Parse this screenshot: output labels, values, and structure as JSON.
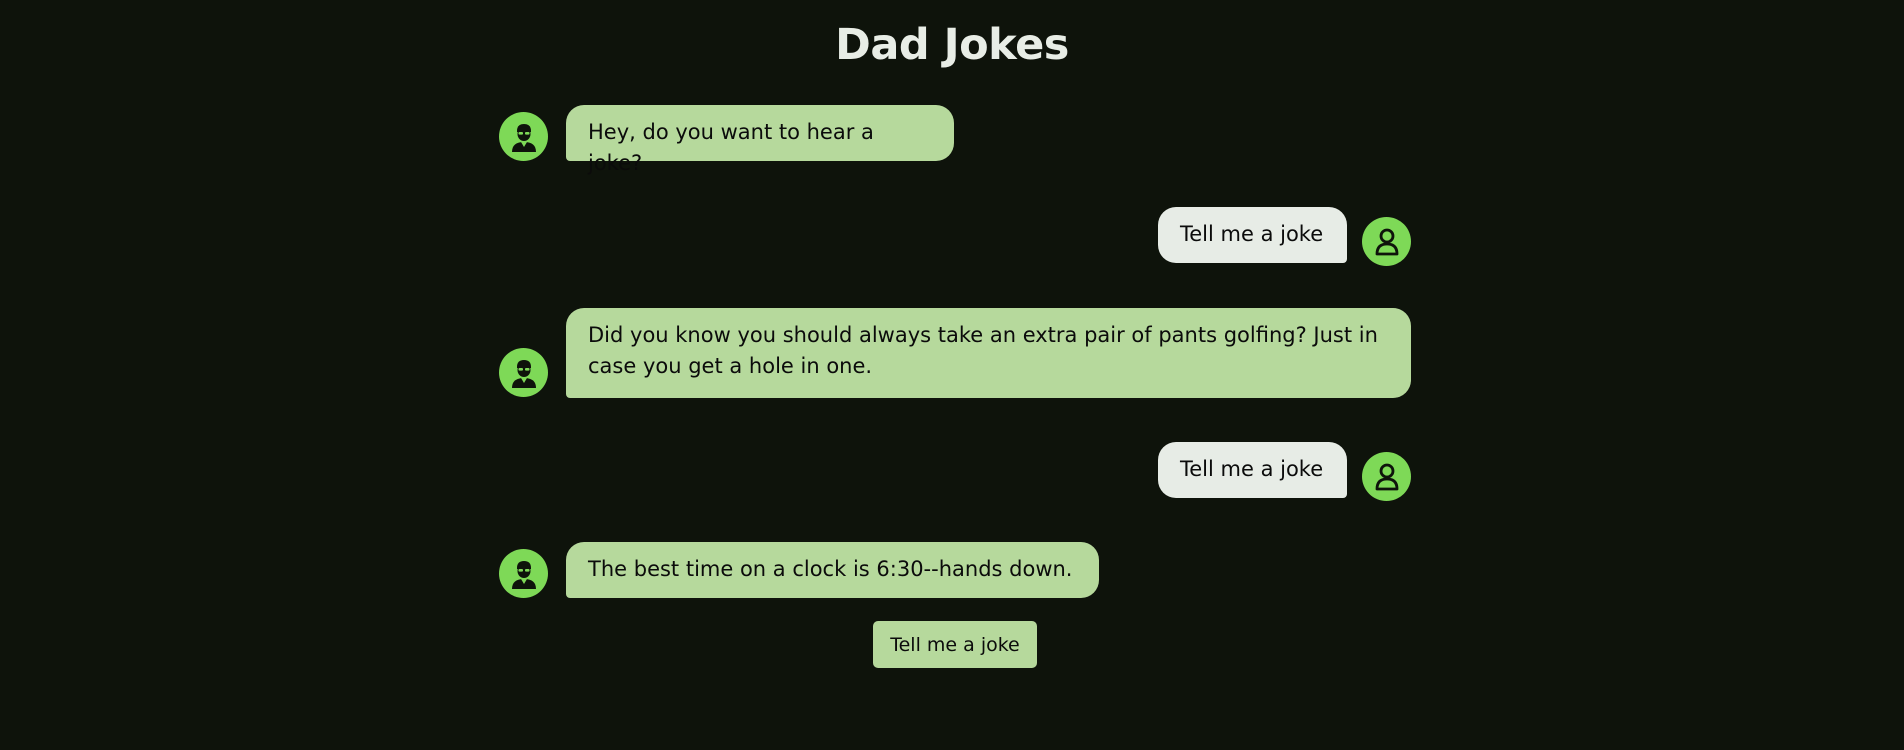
{
  "page": {
    "title": "Dad Jokes"
  },
  "colors": {
    "background": "#0e130b",
    "title": "#e8ede6",
    "avatar": "#7ed957",
    "bot_bubble": "#b6d99c",
    "user_bubble": "#e7ece6",
    "button": "#b6d99c"
  },
  "messages": [
    {
      "sender": "bot",
      "avatar_icon": "dad-avatar-icon",
      "text": "Hey, do you want to hear a joke?"
    },
    {
      "sender": "user",
      "avatar_icon": "user-avatar-icon",
      "text": "Tell me a joke"
    },
    {
      "sender": "bot",
      "avatar_icon": "dad-avatar-icon",
      "text": "Did you know you should always take an extra pair of pants golfing? Just in case you get a hole in one."
    },
    {
      "sender": "user",
      "avatar_icon": "user-avatar-icon",
      "text": "Tell me a joke"
    },
    {
      "sender": "bot",
      "avatar_icon": "dad-avatar-icon",
      "text": "The best time on a clock is 6:30--hands down."
    }
  ],
  "controls": {
    "tell_joke_label": "Tell me a joke"
  }
}
